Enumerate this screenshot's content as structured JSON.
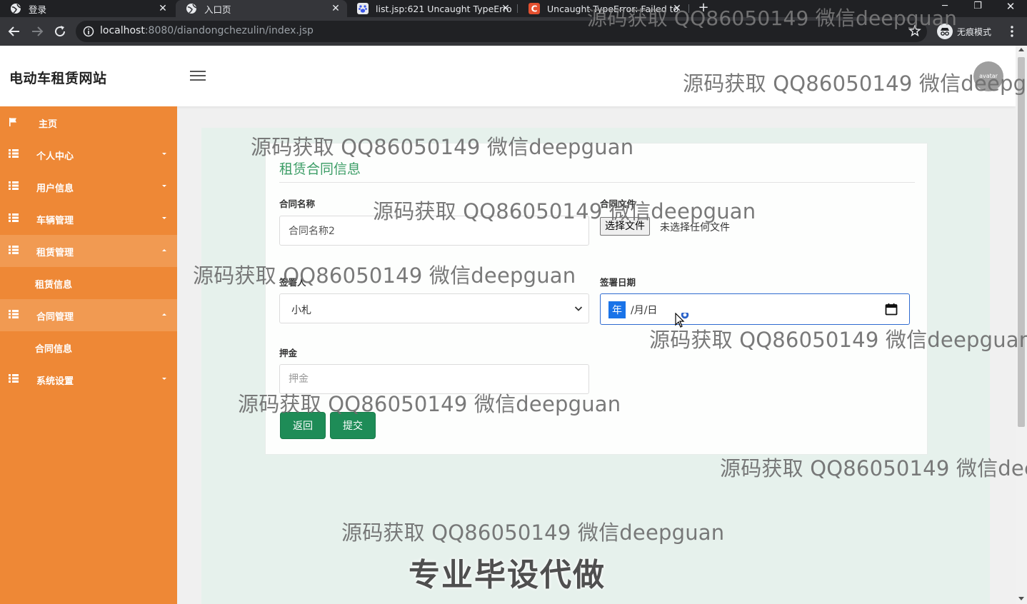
{
  "browser": {
    "tabs": [
      {
        "title": "登录",
        "favicon": "globe-icon",
        "active": false
      },
      {
        "title": "入口页",
        "favicon": "globe-icon",
        "active": true
      },
      {
        "title": "list.jsp:621 Uncaught TypeErro",
        "favicon": "baidu-paw-icon",
        "active": false
      },
      {
        "title": "Uncaught TypeError: Failed to",
        "favicon": "csdn-c-icon",
        "active": false
      }
    ],
    "url_host": "localhost",
    "url_path": ":8080/diandongchezulin/index.jsp",
    "incognito_label": "无痕模式",
    "colors": {
      "tabbar": "#202124",
      "toolbar": "#35363a"
    }
  },
  "header": {
    "brand": "电动车租赁网站",
    "avatar_text": "avatar"
  },
  "sidebar": {
    "color": "#ee8836",
    "items": [
      {
        "label": "主页",
        "icon": "flag-icon"
      },
      {
        "label": "个人中心",
        "icon": "grid-icon",
        "caret": "down"
      },
      {
        "label": "用户信息",
        "icon": "grid-icon",
        "caret": "down"
      },
      {
        "label": "车辆管理",
        "icon": "grid-icon",
        "caret": "down"
      },
      {
        "label": "租赁管理",
        "icon": "grid-icon",
        "caret": "up"
      },
      {
        "label": "租赁信息",
        "sub": true
      },
      {
        "label": "合同管理",
        "icon": "grid-icon",
        "caret": "up"
      },
      {
        "label": "合同信息",
        "sub": true
      },
      {
        "label": "系统设置",
        "icon": "grid-icon",
        "caret": "down"
      }
    ]
  },
  "form": {
    "title": "租赁合同信息",
    "title_color": "#3c9d66",
    "contract_name_label": "合同名称",
    "contract_name_value": "合同名称2",
    "contract_file_label": "合同文件",
    "file_button": "选择文件",
    "file_status": "未选择任何文件",
    "signer_label": "签署人",
    "signer_value": "小札",
    "sign_date_label": "签署日期",
    "date_year": "年",
    "date_rest": "/月/日",
    "deposit_label": "押金",
    "deposit_placeholder": "押金",
    "back_button": "返回",
    "submit_button": "提交",
    "button_color": "#1e8c57"
  },
  "overlay": {
    "watermark": "源码获取 QQ86050149 微信deepguan",
    "watermark_tab": "源码获取 QQ86050149 微信deepguan",
    "watermark_header": "源码获取 QQ86050149 微信deepg",
    "watermark_right": "源码获取 QQ86050149 微信deepguan",
    "watermark_far_right": "源码获取 QQ86050149 微信dee",
    "promo": "专业毕设代做"
  }
}
